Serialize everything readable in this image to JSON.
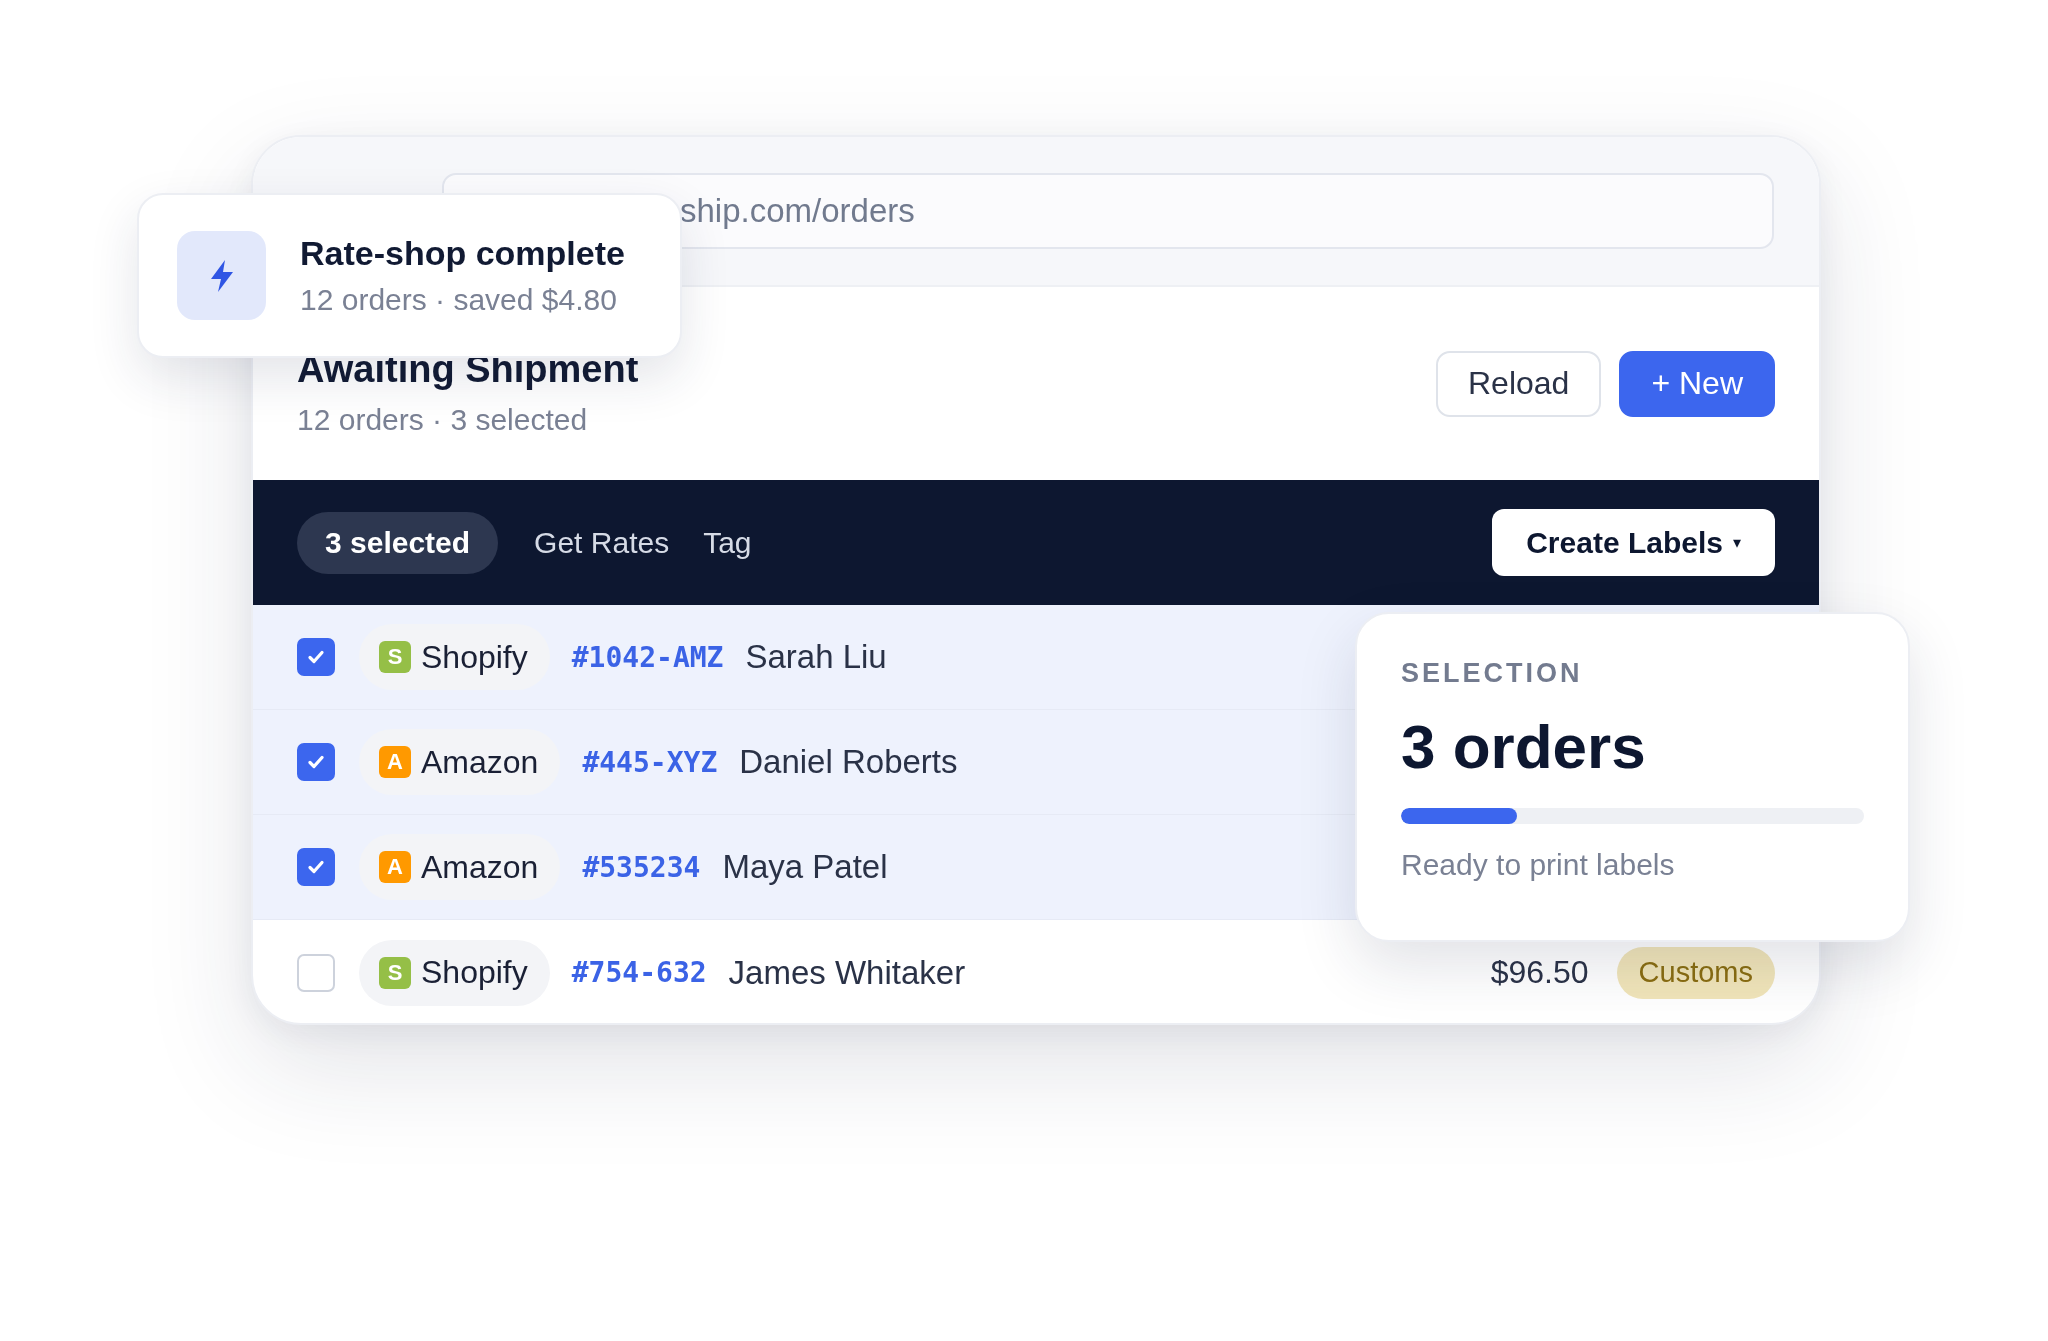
{
  "address_bar": {
    "url": "ship.com/orders"
  },
  "header": {
    "title": "Awaiting Shipment",
    "subtitle": "12 orders · 3 selected",
    "buttons": [
      {
        "label": "Reload",
        "kind": "secondary"
      },
      {
        "label": "+ New",
        "kind": "primary"
      }
    ]
  },
  "action_bar": {
    "selection": "3 selected",
    "actions": [
      "Get Rates",
      "Tag"
    ],
    "primary": "Create Labels",
    "primary_caret": "▾"
  },
  "rows": [
    {
      "checked": true,
      "store": "Shopify",
      "store_letter": "S",
      "color": "#95bf47",
      "order": "#1042-AMZ",
      "customer": "Sarah Liu"
    },
    {
      "checked": true,
      "store": "Amazon",
      "store_letter": "A",
      "color": "#ff9900",
      "order": "#445-XYZ",
      "customer": "Daniel Roberts"
    },
    {
      "checked": true,
      "store": "Amazon",
      "store_letter": "A",
      "color": "#ff9900",
      "order": "#535234",
      "customer": "Maya Patel"
    },
    {
      "checked": false,
      "store": "Shopify",
      "store_letter": "S",
      "color": "#95bf47",
      "order": "#754-632",
      "customer": "James Whitaker",
      "amount": "$96.50",
      "tag": "Customs"
    }
  ],
  "toast": {
    "title": "Rate-shop complete",
    "subtitle": "12 orders · saved $4.80"
  },
  "selection_card": {
    "label": "SELECTION",
    "value": "3 orders",
    "level": 0.25,
    "caption": "Ready to print labels"
  }
}
